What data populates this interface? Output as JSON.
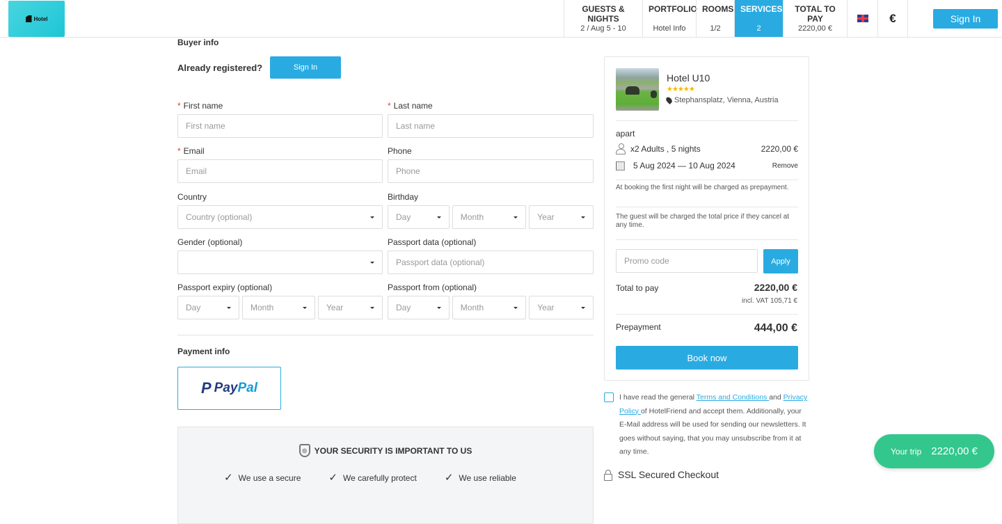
{
  "header": {
    "logo_text": "Hotel",
    "nav": [
      {
        "title": "GUESTS & NIGHTS",
        "sub": "2 / Aug 5 - 10"
      },
      {
        "title": "PORTFOLIO",
        "sub": "Hotel Info"
      },
      {
        "title": "ROOMS",
        "sub": "1/2"
      },
      {
        "title": "SERVICES",
        "sub": "2",
        "active": true
      },
      {
        "title": "TOTAL TO PAY",
        "sub": "2220,00 €"
      }
    ],
    "language_icon": "uk-flag-icon",
    "currency": "€",
    "sign_in_label": "Sign In"
  },
  "buyer": {
    "heading": "Buyer info",
    "already_registered": "Already registered?",
    "sign_in_label": "Sign In",
    "fields": {
      "first_name": {
        "label": "First name",
        "placeholder": "First name",
        "required": true
      },
      "last_name": {
        "label": "Last name",
        "placeholder": "Last name",
        "required": true
      },
      "email": {
        "label": "Email",
        "placeholder": "Email",
        "required": true
      },
      "phone": {
        "label": "Phone",
        "placeholder": "Phone"
      },
      "country": {
        "label": "Country",
        "placeholder": "Country (optional)"
      },
      "birthday": {
        "label": "Birthday",
        "day": "Day",
        "month": "Month",
        "year": "Year"
      },
      "gender": {
        "label": "Gender (optional)",
        "value": ""
      },
      "passport_data": {
        "label": "Passport data (optional)",
        "placeholder": "Passport data (optional)"
      },
      "passport_expiry": {
        "label": "Passport expiry (optional)",
        "day": "Day",
        "month": "Month",
        "year": "Year"
      },
      "passport_from": {
        "label": "Passport from (optional)",
        "day": "Day",
        "month": "Month",
        "year": "Year"
      }
    }
  },
  "payment": {
    "heading": "Payment info",
    "method": "PayPal",
    "method_a": "Pay",
    "method_b": "Pal"
  },
  "security": {
    "title": "YOUR SECURITY IS IMPORTANT TO US",
    "items": [
      "We use a secure",
      "We carefully protect",
      "We use reliable"
    ]
  },
  "summary": {
    "hotel_name": "Hotel U10",
    "stars": 5,
    "stars_text": "★★★★★",
    "address": "Stephansplatz, Vienna, Austria",
    "room_type": "apart",
    "guests": "x2 Adults , 5 nights",
    "room_price": "2220,00 €",
    "dates": "5 Aug 2024 — 10 Aug 2024",
    "remove_label": "Remove",
    "note_prepayment": "At booking the first night will be charged as prepayment.",
    "note_cancel": "The guest will be charged the total price if they cancel at any time.",
    "promo_placeholder": "Promo code",
    "apply_label": "Apply",
    "total_label": "Total to pay",
    "total_value": "2220,00 €",
    "vat": "incl. VAT 105,71 €",
    "prepayment_label": "Prepayment",
    "prepayment_value": "444,00 €",
    "book_label": "Book now"
  },
  "terms": {
    "pre": "I have read the general ",
    "terms_link": "Terms and Conditions ",
    "mid": "and ",
    "privacy_link": "Privacy Policy ",
    "post": "of HotelFriend and accept them. Additionally, your E-Mail address will be used for sending our newsletters. It goes without saying, that you may unsubscribe from it at any time.",
    "checked": false
  },
  "ssl": {
    "label": "SSL Secured Checkout"
  },
  "trip": {
    "label": "Your trip",
    "value": "2220,00 €"
  },
  "colors": {
    "accent": "#29abe2",
    "trip": "#33c78d",
    "required": "#e53935",
    "stars": "#f5b800"
  }
}
